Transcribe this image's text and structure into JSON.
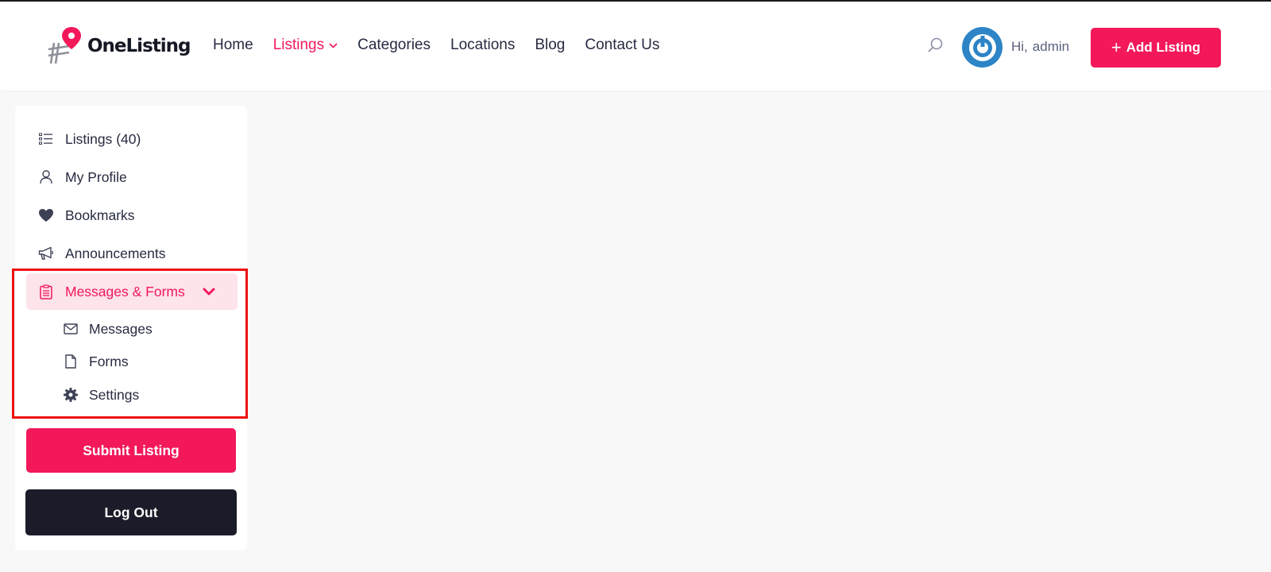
{
  "header": {
    "logo_text": "OneListing",
    "nav": [
      {
        "label": "Home",
        "active": false
      },
      {
        "label": "Listings",
        "active": true,
        "has_dropdown": true
      },
      {
        "label": "Categories",
        "active": false
      },
      {
        "label": "Locations",
        "active": false
      },
      {
        "label": "Blog",
        "active": false
      },
      {
        "label": "Contact Us",
        "active": false
      }
    ],
    "greeting": "Hi,",
    "username": "admin",
    "add_listing_label": "Add Listing"
  },
  "sidebar": {
    "items": [
      {
        "label": "Listings (40)",
        "icon": "list-icon"
      },
      {
        "label": "My Profile",
        "icon": "user-icon"
      },
      {
        "label": "Bookmarks",
        "icon": "heart-icon"
      },
      {
        "label": "Announcements",
        "icon": "megaphone-icon"
      },
      {
        "label": "Messages & Forms",
        "icon": "clipboard-icon",
        "expanded": true
      }
    ],
    "submenu": [
      {
        "label": "Messages",
        "icon": "envelope-icon"
      },
      {
        "label": "Forms",
        "icon": "file-icon"
      },
      {
        "label": "Settings",
        "icon": "gear-icon"
      }
    ],
    "submit_label": "Submit Listing",
    "logout_label": "Log Out"
  },
  "colors": {
    "accent": "#f2185a",
    "accent_light": "#fde3ea",
    "dark_button": "#1b1c29",
    "highlight_border": "#ee1111",
    "avatar": "#2d84c6"
  }
}
